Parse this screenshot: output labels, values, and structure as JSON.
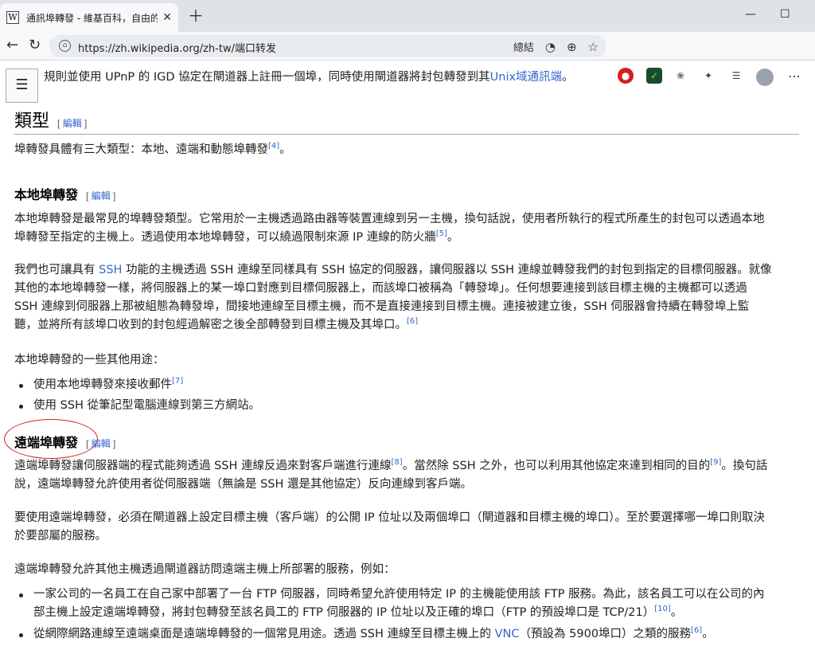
{
  "browser": {
    "tab_title": "通訊埠轉發 - 維基百科，自由的百科全書",
    "url": "https://zh.wikipedia.org/zh-tw/端口转发",
    "read_aloud": "總結"
  },
  "article": {
    "cut_line": "規則並使用 UPnP 的 IGD 協定在閘道器上註冊一個埠，同時使用閘道器將封包轉發到其",
    "cut_line_link": "Unix域通訊端",
    "cut_line_end": "。",
    "edit_label": "編輯",
    "types": {
      "heading": "類型",
      "text": "埠轉發具體有三大類型：本地、遠端和動態埠轉發",
      "ref": "[4]",
      "text_end": "。"
    },
    "local": {
      "heading": "本地埠轉發",
      "p1a": "本地埠轉發是最常見的埠轉發類型。它常用於一主機透過路由器等裝置連線到另一主機，換句話說，使用者所執行的程式所產生的封包可以透過本地",
      "p1b": "埠轉發至指定的主機上。透過使用本地埠轉發，可以繞過限制來源 IP 連線的防火牆",
      "ref5": "[5]",
      "p1_end": "。",
      "p2_pre": "我們也可讓具有 ",
      "p2_link": "SSH",
      "p2a": " 功能的主機透過 SSH 連線至同樣具有 SSH 協定的伺服器，讓伺服器以 SSH 連線並轉發我們的封包到指定的目標伺服器。就像",
      "p2b": "其他的本地埠轉發一樣，將伺服器上的某一埠口對應到目標伺服器上，而該埠口被稱為「轉發埠」。任何想要連接到該目標主機的主機都可以透過",
      "p2c": "SSH 連線到伺服器上那被組態為轉發埠，間接地連線至目標主機，而不是直接連接到目標主機。連接被建立後，SSH 伺服器會持續在轉發埠上監",
      "p2d": "聽，並將所有該埠口收到的封包經過解密之後全部轉發到目標主機及其埠口。",
      "ref6": "[6]",
      "uses_intro": "本地埠轉發的一些其他用途：",
      "use1": "使用本地埠轉發來接收郵件",
      "ref7": "[7]",
      "use2": "使用 SSH 從筆記型電腦連線到第三方網站。"
    },
    "remote": {
      "heading": "遠端埠轉發",
      "p1a": "遠端埠轉發讓伺服器端的程式能夠透過 SSH 連線反過來對客戶端進行連線",
      "ref8": "[8]",
      "p1b": "。當然除 SSH 之外，也可以利用其他協定來達到相同的目的",
      "ref9": "[9]",
      "p1c": "。換句話",
      "p1d": "說，遠端埠轉發允許使用者從伺服器端（無論是 SSH 還是其他協定）反向連線到客戶端。",
      "p2a": "要使用遠端埠轉發，必須在閘道器上設定目標主機（客戶端）的公開 IP 位址以及兩個埠口（閘道器和目標主機的埠口）。至於要選擇哪一埠口則取決",
      "p2b": "於要部屬的服務。",
      "p3": "遠端埠轉發允許其他主機透過閘道器訪問遠端主機上所部署的服務，例如：",
      "li1a": "一家公司的一名員工在自己家中部署了一台 FTP 伺服器，同時希望允許使用特定 IP 的主機能使用該 FTP 服務。為此，該名員工可以在公司的內",
      "li1b": "部主機上設定遠端埠轉發，將封包轉發至該名員工的 FTP 伺服器的 IP 位址以及正確的埠口（FTP 的預設埠口是 TCP/21）",
      "ref10": "[10]",
      "li1_end": "。",
      "li2a": "從網際網路連線至遠端桌面是遠端埠轉發的一個常見用途。透過 SSH 連線至目標主機上的 ",
      "li2_link": "VNC",
      "li2b": "（預設為 5900埠口）之類的服務",
      "ref6": "[6]",
      "li2_end": "。"
    }
  }
}
